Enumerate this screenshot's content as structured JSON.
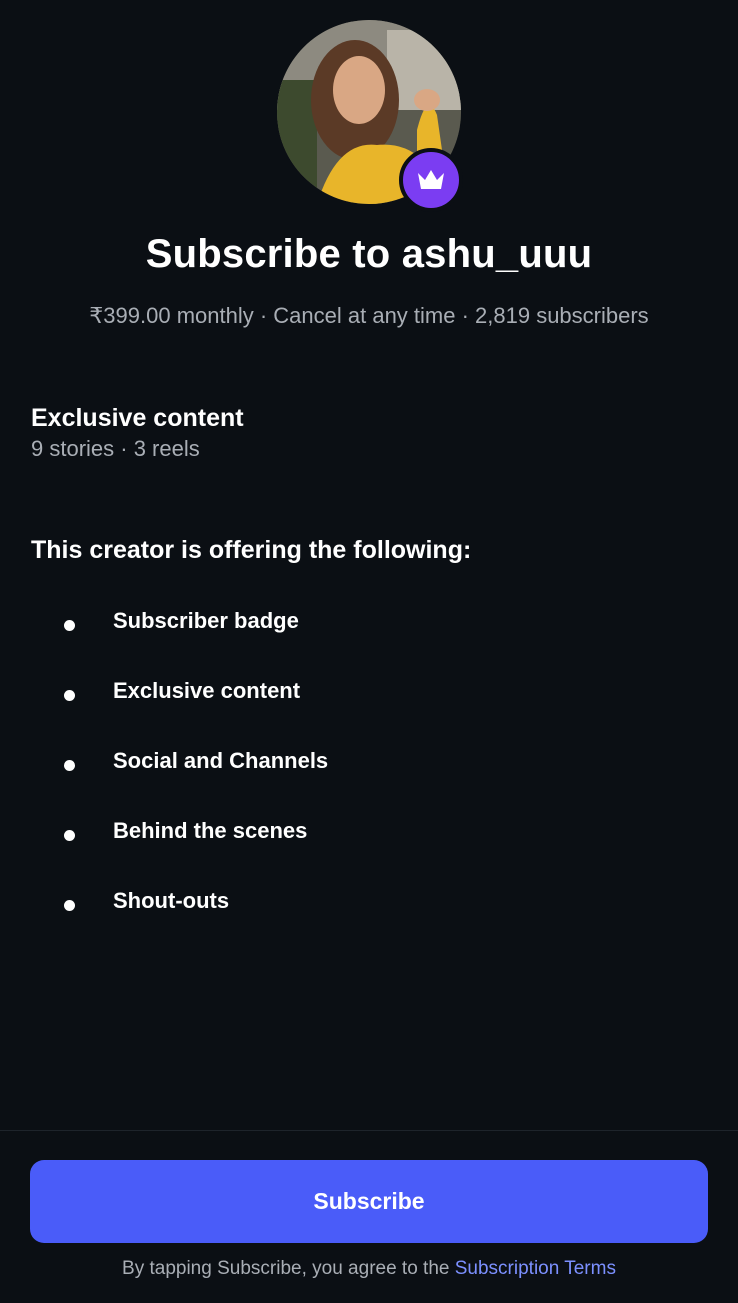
{
  "creator": {
    "avatar_icon": "profile-photo",
    "badge_icon": "crown-icon",
    "badge_color": "#7b3df2"
  },
  "header": {
    "title": "Subscribe to ashu_uuu",
    "meta": "₹399.00 monthly · Cancel at any time · 2,819 subscribers"
  },
  "exclusive": {
    "title": "Exclusive content",
    "subtitle": "9 stories · 3 reels"
  },
  "offers": {
    "title": "This creator is offering the following:",
    "items": [
      {
        "label": "Subscriber badge"
      },
      {
        "label": "Exclusive content"
      },
      {
        "label": "Social and Channels"
      },
      {
        "label": "Behind the scenes"
      },
      {
        "label": "Shout-outs"
      }
    ]
  },
  "actions": {
    "subscribe_label": "Subscribe",
    "accent": "#4a5cf9"
  },
  "footer": {
    "text": "By tapping Subscribe, you agree to the ",
    "link": "Subscription Terms"
  }
}
